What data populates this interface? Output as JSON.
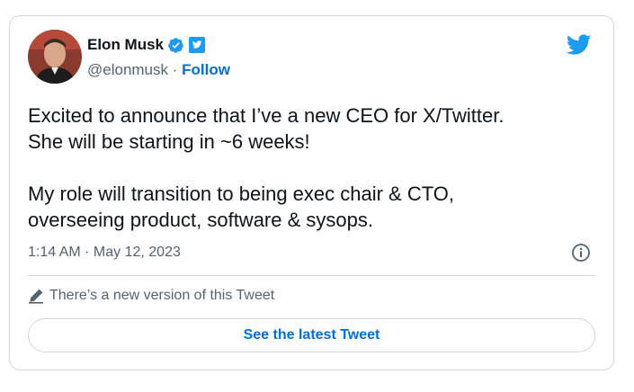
{
  "author": {
    "name": "Elon Musk",
    "handle": "@elonmusk",
    "separator": " · ",
    "follow_label": "Follow",
    "avatar_icon": "avatar",
    "verified_icon": "verified-badge-icon",
    "gov_icon": "twitter-affiliate-badge-icon"
  },
  "brand_icon": "twitter-bird-icon",
  "tweet": {
    "text": "Excited to announce that I’ve a new CEO for X/Twitter.\nShe will be starting in ~6 weeks!\n\nMy role will transition to being exec chair & CTO,\noverseeing product, software & sysops.",
    "timestamp": "1:14 AM · May 12, 2023",
    "info_icon": "info-icon"
  },
  "edit_notice": {
    "icon": "pencil-icon",
    "text": "There’s a new version of this Tweet",
    "button_label": "See the latest Tweet"
  },
  "colors": {
    "accent": "#1d9bf0",
    "link": "#006fd6",
    "text": "#0f1419",
    "muted": "#536471",
    "border": "#cfd9de"
  }
}
